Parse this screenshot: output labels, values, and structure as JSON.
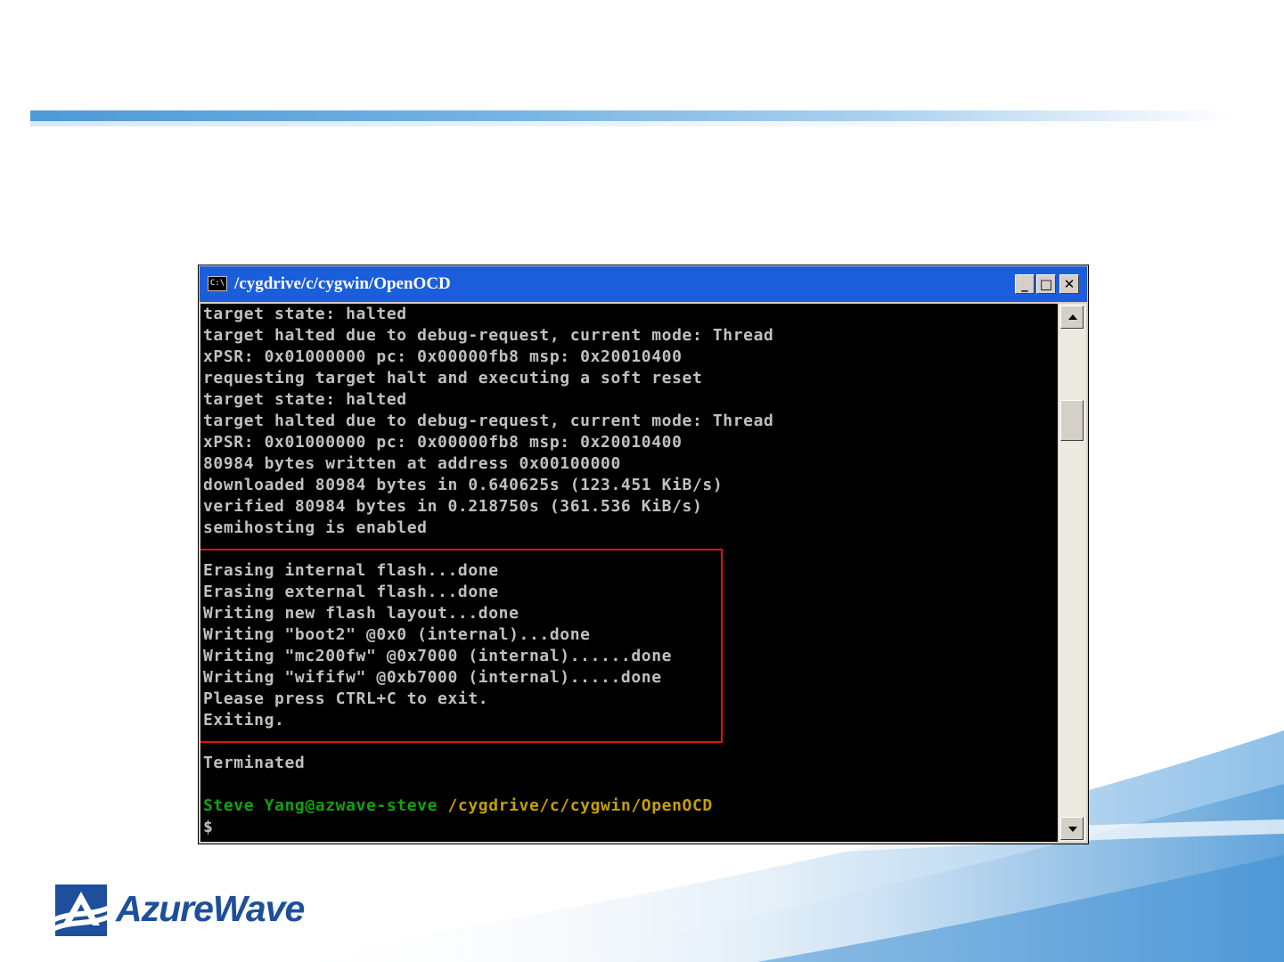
{
  "window": {
    "title": "/cygdrive/c/cygwin/OpenOCD",
    "icon_label": "C:\\",
    "buttons": {
      "minimize": "_",
      "maximize": "□",
      "close": "✕"
    }
  },
  "console": {
    "lines": [
      "target state: halted",
      "target halted due to debug-request, current mode: Thread",
      "xPSR: 0x01000000 pc: 0x00000fb8 msp: 0x20010400",
      "requesting target halt and executing a soft reset",
      "target state: halted",
      "target halted due to debug-request, current mode: Thread",
      "xPSR: 0x01000000 pc: 0x00000fb8 msp: 0x20010400",
      "80984 bytes written at address 0x00100000",
      "downloaded 80984 bytes in 0.640625s (123.451 KiB/s)",
      "verified 80984 bytes in 0.218750s (361.536 KiB/s)",
      "semihosting is enabled",
      "",
      "Erasing internal flash...done",
      "Erasing external flash...done",
      "Writing new flash layout...done",
      "Writing \"boot2\" @0x0 (internal)...done",
      "Writing \"mc200fw\" @0x7000 (internal)......done",
      "Writing \"wififw\" @0xb7000 (internal).....done",
      "Please press CTRL+C to exit.",
      "Exiting.",
      "",
      "Terminated",
      ""
    ],
    "prompt_user": "Steve Yang@azwave-steve",
    "prompt_path": "/cygdrive/c/cygwin/OpenOCD",
    "prompt_symbol": "$"
  },
  "logo": {
    "text": "AzureWave"
  },
  "colors": {
    "title_bar": "#1b5edb",
    "console_bg": "#000000",
    "console_text": "#c0c0c0",
    "prompt_green": "#13a10e",
    "prompt_yellow": "#c4a000",
    "highlight_box": "#e0101c",
    "logo_blue": "#1d4f9c"
  }
}
